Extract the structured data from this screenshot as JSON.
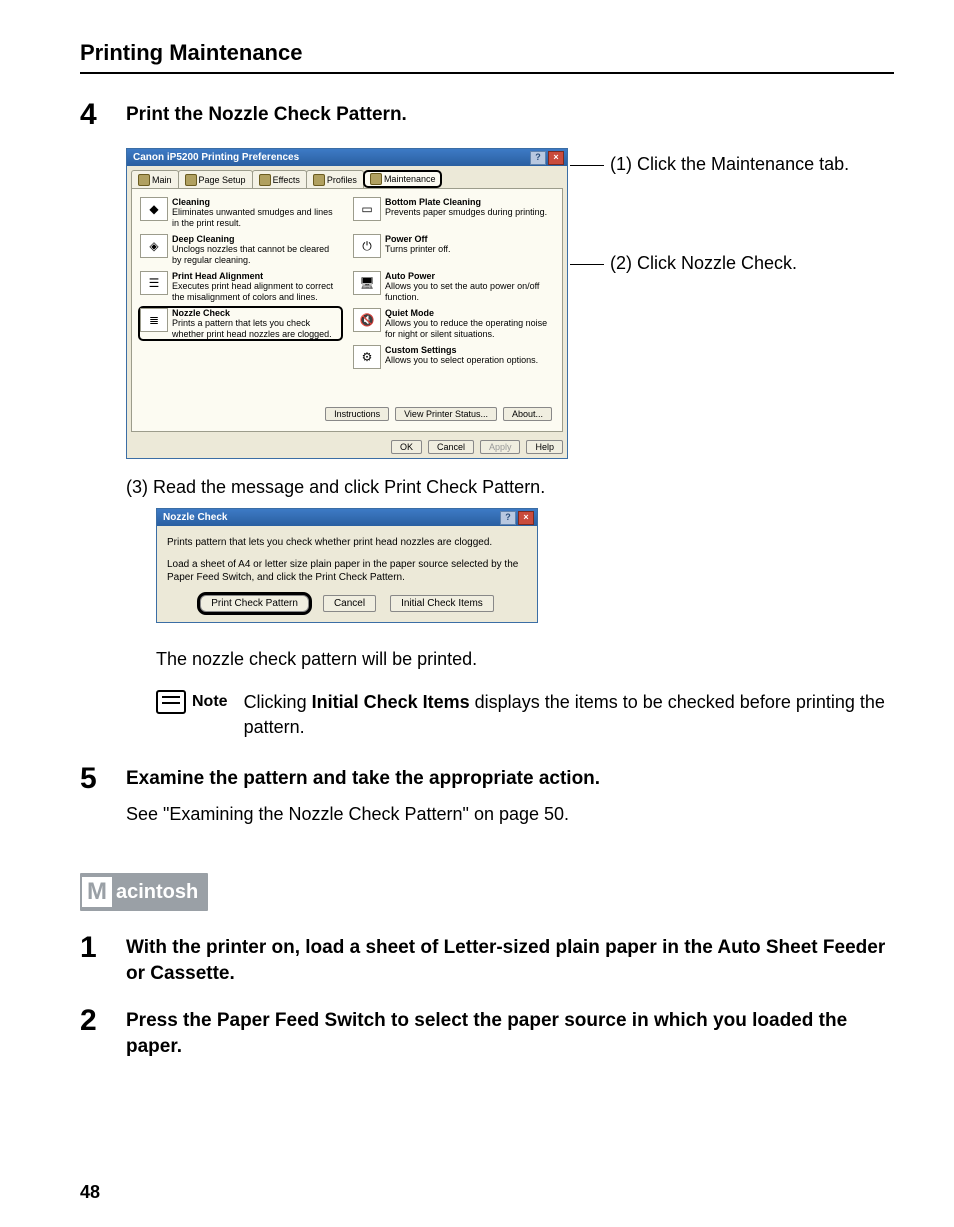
{
  "section_title": "Printing Maintenance",
  "step4": {
    "num": "4",
    "title": "Print the Nozzle Check Pattern.",
    "callout1": "(1) Click the Maintenance tab.",
    "callout2": "(2) Click Nozzle Check.",
    "substep": "(3) Read the message and click Print Check Pattern.",
    "printed_line": "The nozzle check pattern will be printed.",
    "note_label": "Note",
    "note_text_pre": "Clicking ",
    "note_text_bold": "Initial Check Items",
    "note_text_post": " displays the items to be checked before printing the pattern."
  },
  "prefs": {
    "title": "Canon iP5200 Printing Preferences",
    "tabs": {
      "main": "Main",
      "page": "Page Setup",
      "effects": "Effects",
      "profiles": "Profiles",
      "maintenance": "Maintenance"
    },
    "items": {
      "cleaning": {
        "t": "Cleaning",
        "d": "Eliminates unwanted smudges and lines in the print result."
      },
      "deep": {
        "t": "Deep Cleaning",
        "d": "Unclogs nozzles that cannot be cleared by regular cleaning."
      },
      "head": {
        "t": "Print Head Alignment",
        "d": "Executes print head alignment to correct the misalignment of colors and lines."
      },
      "nozzle": {
        "t": "Nozzle Check",
        "d": "Prints a pattern that lets you check whether print head nozzles are clogged."
      },
      "bottom": {
        "t": "Bottom Plate Cleaning",
        "d": "Prevents paper smudges during printing."
      },
      "power": {
        "t": "Power Off",
        "d": "Turns printer off."
      },
      "auto": {
        "t": "Auto Power",
        "d": "Allows you to set the auto power on/off function."
      },
      "quiet": {
        "t": "Quiet Mode",
        "d": "Allows you to reduce the operating noise for night or silent situations."
      },
      "custom": {
        "t": "Custom Settings",
        "d": "Allows you to select operation options."
      }
    },
    "btns": {
      "instructions": "Instructions",
      "status": "View Printer Status...",
      "about": "About...",
      "ok": "OK",
      "cancel": "Cancel",
      "apply": "Apply",
      "help": "Help"
    },
    "close_q": "?",
    "close_x": "×"
  },
  "nzl": {
    "title": "Nozzle Check",
    "line1": "Prints pattern that lets you check whether print head nozzles are clogged.",
    "line2": "Load a sheet of A4 or letter size plain paper in the paper source selected by the Paper Feed Switch, and click the Print Check Pattern.",
    "btn_print": "Print Check Pattern",
    "btn_cancel": "Cancel",
    "btn_items": "Initial Check Items",
    "close_q": "?",
    "close_x": "×"
  },
  "step5": {
    "num": "5",
    "title": "Examine the pattern and take the appropriate action.",
    "sub": "See \"Examining the Nozzle Check Pattern\" on page 50."
  },
  "mac": {
    "big": "M",
    "rest": "acintosh"
  },
  "mac_step1": {
    "num": "1",
    "title": "With the printer on, load a sheet of Letter-sized plain paper in the Auto Sheet Feeder or Cassette."
  },
  "mac_step2": {
    "num": "2",
    "title": "Press the Paper Feed Switch to select the paper source in which you loaded the paper."
  },
  "page_number": "48"
}
